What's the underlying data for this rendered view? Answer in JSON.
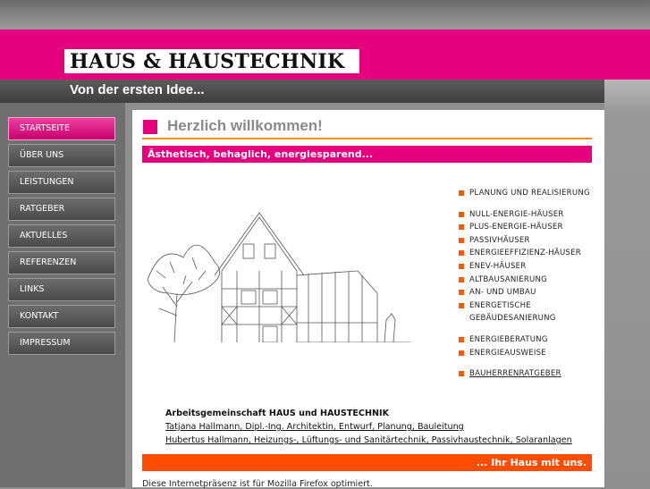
{
  "header": {
    "logo_text": "HAUS & HAUSTECHNIK",
    "tagline": "Von der ersten Idee..."
  },
  "nav": {
    "items": [
      {
        "label": "STARTSEITE",
        "active": true
      },
      {
        "label": "ÜBER UNS",
        "active": false
      },
      {
        "label": "LEISTUNGEN",
        "active": false
      },
      {
        "label": "RATGEBER",
        "active": false
      },
      {
        "label": "AKTUELLES",
        "active": false
      },
      {
        "label": "REFERENZEN",
        "active": false
      },
      {
        "label": "LINKS",
        "active": false
      },
      {
        "label": "KONTAKT",
        "active": false
      },
      {
        "label": "IMPRESSUM",
        "active": false
      }
    ]
  },
  "main": {
    "title": "Herzlich willkommen!",
    "slogan": "Ästhetisch, behaglich, energiesparend...",
    "services": [
      {
        "label": "PLANUNG UND REALISIERUNG",
        "link": false
      },
      {
        "label": "NULL-ENERGIE-HÄUSER",
        "link": false
      },
      {
        "label": "PLUS-ENERGIE-HÄUSER",
        "link": false
      },
      {
        "label": "PASSIVHÄUSER",
        "link": false
      },
      {
        "label": "ENERGIEEFFIZIENZ-HÄUSER",
        "link": false
      },
      {
        "label": "ENEV-HÄUSER",
        "link": false
      },
      {
        "label": "ALTBAUSANIERUNG",
        "link": false
      },
      {
        "label": "AN- UND UMBAU",
        "link": false
      },
      {
        "label": "ENERGETISCHE GEBÄUDESANIERUNG",
        "link": false
      },
      {
        "label": "ENERGIEBERATUNG",
        "link": false
      },
      {
        "label": "ENERGIEAUSWEISE",
        "link": false
      },
      {
        "label": "BAUHERRENRATGEBER",
        "link": true
      }
    ],
    "contact": {
      "heading": "Arbeitsgemeinschaft HAUS und HAUSTECHNIK",
      "line1": "Tatjana Hallmann, Dipl.-Ing. Architektin, Entwurf, Planung, Bauleitung",
      "line2": "Hubertus Hallmann, Heizungs-, Lüftungs- und Sanitärtechnik, Passivhaustechnik, Solaranlagen"
    },
    "footer_slogan": "... Ihr Haus mit uns.",
    "browser_note": "Diese Internetpräsenz ist für Mozilla Firefox optimiert."
  },
  "colors": {
    "brand_magenta": "#e5007e",
    "accent_orange": "#ff4d00"
  }
}
